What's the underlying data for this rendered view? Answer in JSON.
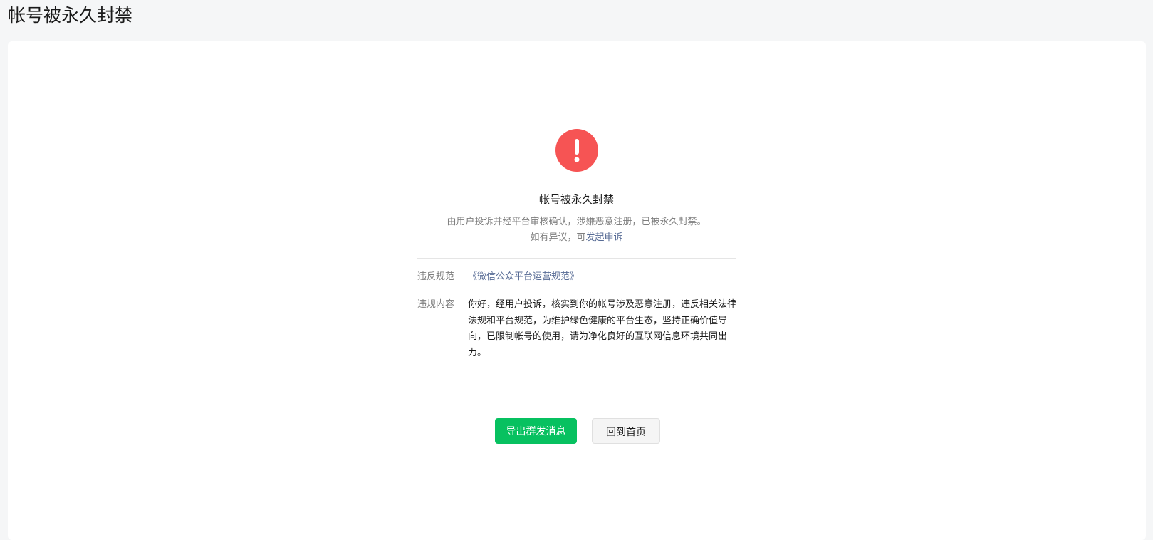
{
  "page": {
    "title": "帐号被永久封禁"
  },
  "status": {
    "icon": "exclamation-icon",
    "accent_color": "#f65454",
    "title": "帐号被永久封禁",
    "description": "由用户投诉并经平台审核确认，涉嫌恶意注册，已被永久封禁。",
    "appeal_prefix": "如有异议，可",
    "appeal_link": "发起申诉"
  },
  "details": {
    "rule_label": "违反规范",
    "rule_value": "《微信公众平台运营规范》",
    "content_label": "违规内容",
    "content_value": "你好，经用户投诉，核实到你的帐号涉及恶意注册，违反相关法律法规和平台规范，为维护绿色健康的平台生态，坚持正确价值导向，已限制帐号的使用，请为净化良好的互联网信息环境共同出力。"
  },
  "actions": {
    "export_label": "导出群发消息",
    "export_color": "#07c160",
    "home_label": "回到首页"
  }
}
